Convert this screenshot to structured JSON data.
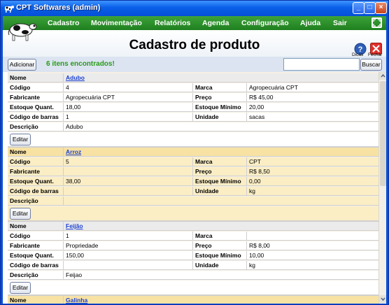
{
  "window": {
    "title": "CPT Softwares (admin)",
    "colors": {
      "titlebar": "#0a5fe8",
      "menubar": "#2a8f2a",
      "link": "#1a3fd1",
      "found": "#2a9a1a",
      "alt_row": "#fbeec5"
    }
  },
  "menu": {
    "items": [
      "Cadastro",
      "Movimentação",
      "Relatórios",
      "Agenda",
      "Configuração",
      "Ajuda",
      "Sair"
    ]
  },
  "header": {
    "title": "Cadastro de produto",
    "help_label": "Dicas",
    "close_label": "Fechar"
  },
  "toolbar": {
    "add_label": "Adicionar",
    "found_text": "6 itens encontrados!",
    "search_value": "",
    "search_button": "Buscar"
  },
  "labels": {
    "nome": "Nome",
    "codigo": "Código",
    "marca": "Marca",
    "fabricante": "Fabricante",
    "preco": "Preço",
    "estoque": "Estoque Quant.",
    "estoque_min": "Estoque Mínimo",
    "barras": "Código de barras",
    "unidade": "Unidade",
    "descricao": "Descrição",
    "editar": "Editar"
  },
  "products": [
    {
      "nome": "Adubo",
      "codigo": "4",
      "marca": "Agropecuária CPT",
      "fabricante": "Agropecuária CPT",
      "preco": "R$ 45,00",
      "estoque": "18,00",
      "estoque_min": "20,00",
      "barras": "1",
      "unidade": "sacas",
      "descricao": "Adubo"
    },
    {
      "nome": "Arroz",
      "codigo": "5",
      "marca": "CPT",
      "fabricante": "",
      "preco": "R$ 8,50",
      "estoque": "38,00",
      "estoque_min": "0,00",
      "barras": "",
      "unidade": "kg",
      "descricao": ""
    },
    {
      "nome": "Feijão",
      "codigo": "1",
      "marca": "",
      "fabricante": "Propriedade",
      "preco": "R$ 8,00",
      "estoque": "150,00",
      "estoque_min": "10,00",
      "barras": "",
      "unidade": "kg",
      "descricao": "Feijao"
    },
    {
      "nome": "Galinha"
    }
  ]
}
